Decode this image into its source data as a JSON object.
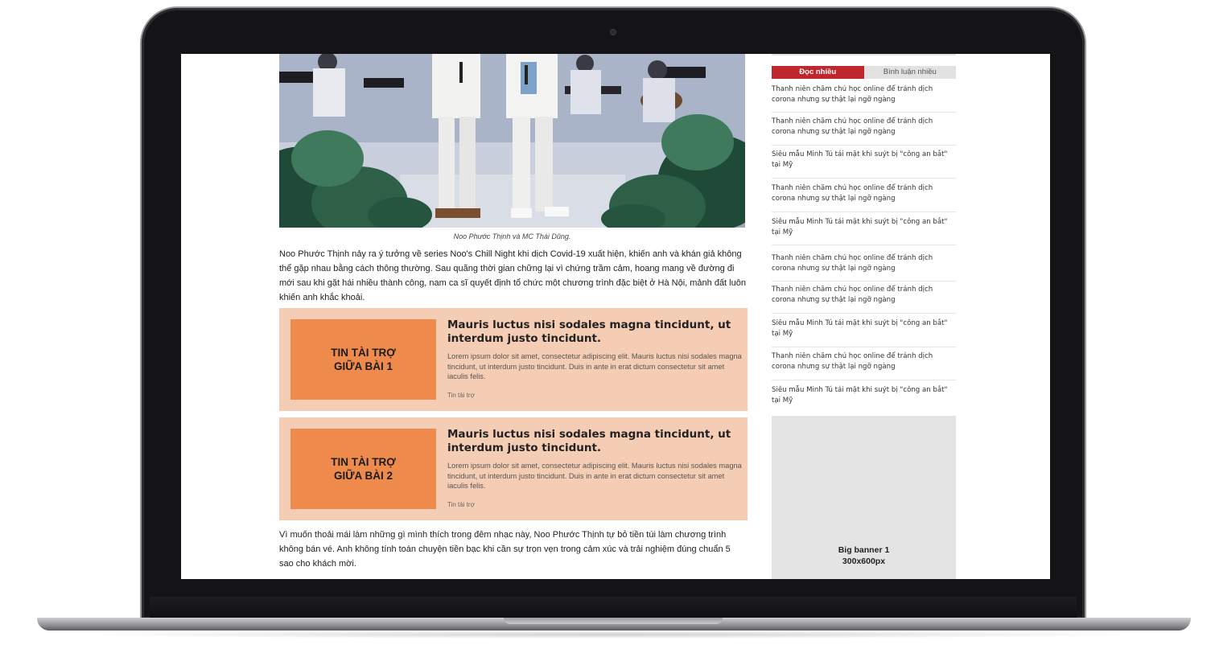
{
  "article": {
    "photo_caption": "Noo Phước Thịnh và MC Thái Dũng.",
    "paragraph_1": "Noo Phước Thịnh nảy ra ý tưởng về series Noo's Chill Night khi dịch Covid-19 xuất hiện, khiến anh và khán giả không thể gặp nhau bằng cách thông thường. Sau quãng thời gian chững lại vì chứng trầm cảm, hoang mang về đường đi mới sau khi gặt hái nhiều thành công, nam ca sĩ quyết định tổ chức một chương trình đặc biệt ở Hà Nội, mảnh đất luôn khiến anh khắc khoải.",
    "paragraph_2": "Vì muốn thoải mái làm những gì mình thích trong đêm nhạc này, Noo Phước Thịnh tự bỏ tiền túi làm chương trình không bán vé. Anh không tính toán chuyện tiền bạc khi cần sự trọn vẹn trong cảm xúc và trải nghiệm đúng chuẩn 5 sao cho khách mời."
  },
  "ads": [
    {
      "box_label": "TIN TÀI TRỢ\nGIỮA BÀI 1",
      "title": "Mauris luctus nisi sodales magna tincidunt, ut interdum justo tincidunt.",
      "description": "Lorem ipsum dolor sit amet, consectetur adipiscing elit. Mauris luctus nisi sodales magna tincidunt, ut interdum justo tincidunt. Duis in ante in erat dictum consectetur sit amet iaculis felis.",
      "label": "Tin tài trợ"
    },
    {
      "box_label": "TIN TÀI TRỢ\nGIỮA BÀI 2",
      "title": "Mauris luctus nisi sodales magna tincidunt, ut interdum justo tincidunt.",
      "description": "Lorem ipsum dolor sit amet, consectetur adipiscing elit. Mauris luctus nisi sodales magna tincidunt, ut interdum justo tincidunt. Duis in ante in erat dictum consectetur sit amet iaculis felis.",
      "label": "Tin tài trợ"
    }
  ],
  "sidebar": {
    "tabs": [
      {
        "label": "Đọc nhiều",
        "active": true
      },
      {
        "label": "Bình luận nhiều",
        "active": false
      }
    ],
    "items": [
      "Thanh niên chăm chú học online để tránh dịch corona nhưng sự thật lại ngỡ ngàng",
      "Thanh niên chăm chú học online để tránh dịch corona nhưng sự thật lại ngỡ ngàng",
      "Siêu mẫu Minh Tú tái mặt khi suýt bị \"công an bắt\" tại Mỹ",
      "Thanh niên chăm chú học online để tránh dịch corona nhưng sự thật lại ngỡ ngàng",
      "Siêu mẫu Minh Tú tái mặt khi suýt bị \"công an bắt\" tại Mỹ",
      "Thanh niên chăm chú học online để tránh dịch corona nhưng sự thật lại ngỡ ngàng",
      "Thanh niên chăm chú học online để tránh dịch corona nhưng sự thật lại ngỡ ngàng",
      "Siêu mẫu Minh Tú tái mặt khi suýt bị \"công an bắt\" tại Mỹ",
      "Thanh niên chăm chú học online để tránh dịch corona nhưng sự thật lại ngỡ ngàng",
      "Siêu mẫu Minh Tú tái mặt khi suýt bị \"công an bắt\" tại Mỹ"
    ],
    "banner": "Big banner 1\n300x600px"
  },
  "colors": {
    "tab_active": "#c0272d",
    "ad_background": "#f5cdb4",
    "ad_box": "#ee8a4c",
    "banner_background": "#e4e4e4"
  }
}
